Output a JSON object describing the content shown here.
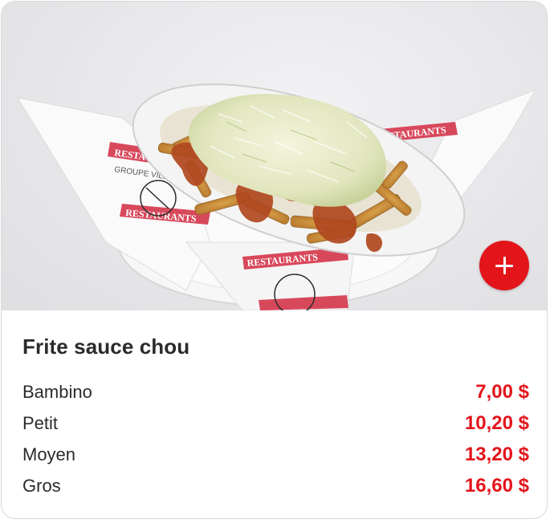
{
  "item": {
    "name": "Frite sauce chou",
    "image_alt": "Frite sauce chou",
    "add_icon": "plus-icon"
  },
  "colors": {
    "accent": "#e3151b",
    "text": "#2b2b2b",
    "border": "#d9d9d9"
  },
  "sizes": [
    {
      "label": "Bambino",
      "price": "7,00 $"
    },
    {
      "label": "Petit",
      "price": "10,20 $"
    },
    {
      "label": "Moyen",
      "price": "13,20 $"
    },
    {
      "label": "Gros",
      "price": "16,60 $"
    }
  ],
  "photo_text": {
    "brand": "RESTAURANTS",
    "group": "GROUPE VILLAGEOIS"
  }
}
